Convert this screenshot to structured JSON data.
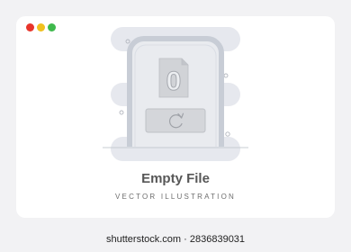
{
  "window_controls": [
    {
      "name": "close",
      "color": "#e8352b"
    },
    {
      "name": "minimize",
      "color": "#f0c01e"
    },
    {
      "name": "maximize",
      "color": "#3fb94c"
    }
  ],
  "illustration": {
    "file_glyph": "0",
    "icon": "refresh-icon",
    "background_color": "#e6e8ee",
    "frame_color": "#c8cdd6",
    "door_color": "#e9ebef",
    "icon_color": "#bdbdc0"
  },
  "title": "Empty File",
  "subtitle": "VECTOR ILLUSTRATION",
  "watermark": "shutterstock.com · 2836839031"
}
